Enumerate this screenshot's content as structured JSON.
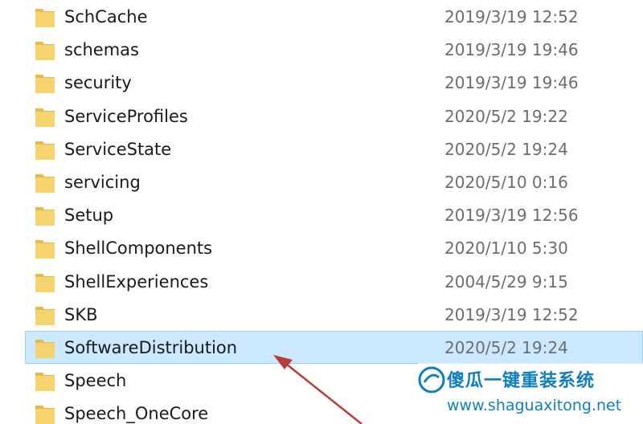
{
  "files": [
    {
      "name": "SchCache",
      "modified": "2019/3/19 12:52",
      "icon": "folder-icon"
    },
    {
      "name": "schemas",
      "modified": "2019/3/19 19:46",
      "icon": "folder-icon"
    },
    {
      "name": "security",
      "modified": "2019/3/19 19:46",
      "icon": "folder-icon"
    },
    {
      "name": "ServiceProfiles",
      "modified": "2020/5/2 19:22",
      "icon": "folder-icon"
    },
    {
      "name": "ServiceState",
      "modified": "2020/5/2 19:24",
      "icon": "folder-icon"
    },
    {
      "name": "servicing",
      "modified": "2020/5/10 0:16",
      "icon": "folder-icon"
    },
    {
      "name": "Setup",
      "modified": "2019/3/19 12:56",
      "icon": "folder-icon"
    },
    {
      "name": "ShellComponents",
      "modified": "2020/1/10 5:30",
      "icon": "folder-icon"
    },
    {
      "name": "ShellExperiences",
      "modified": "2004/5/29 9:15",
      "icon": "folder-icon"
    },
    {
      "name": "SKB",
      "modified": "2019/3/19 12:52",
      "icon": "folder-icon"
    },
    {
      "name": "SoftwareDistribution",
      "modified": "2020/5/2 19:24",
      "icon": "folder-icon",
      "selected": true
    },
    {
      "name": "Speech",
      "modified": "",
      "icon": "folder-icon"
    },
    {
      "name": "Speech_OneCore",
      "modified": "",
      "icon": "folder-icon"
    }
  ],
  "annotation": {
    "icon": "red-arrow-icon",
    "color": "#b83c3c"
  },
  "watermark": {
    "title": "傻瓜一键重装系统",
    "url": "www.shaguaxitong.net",
    "color": "#0f7fbf"
  },
  "colors": {
    "selection_bg": "#cce8ff",
    "selection_border": "#99d1ff",
    "folder": "#f5d36e",
    "date_text": "#6d6d6d"
  }
}
